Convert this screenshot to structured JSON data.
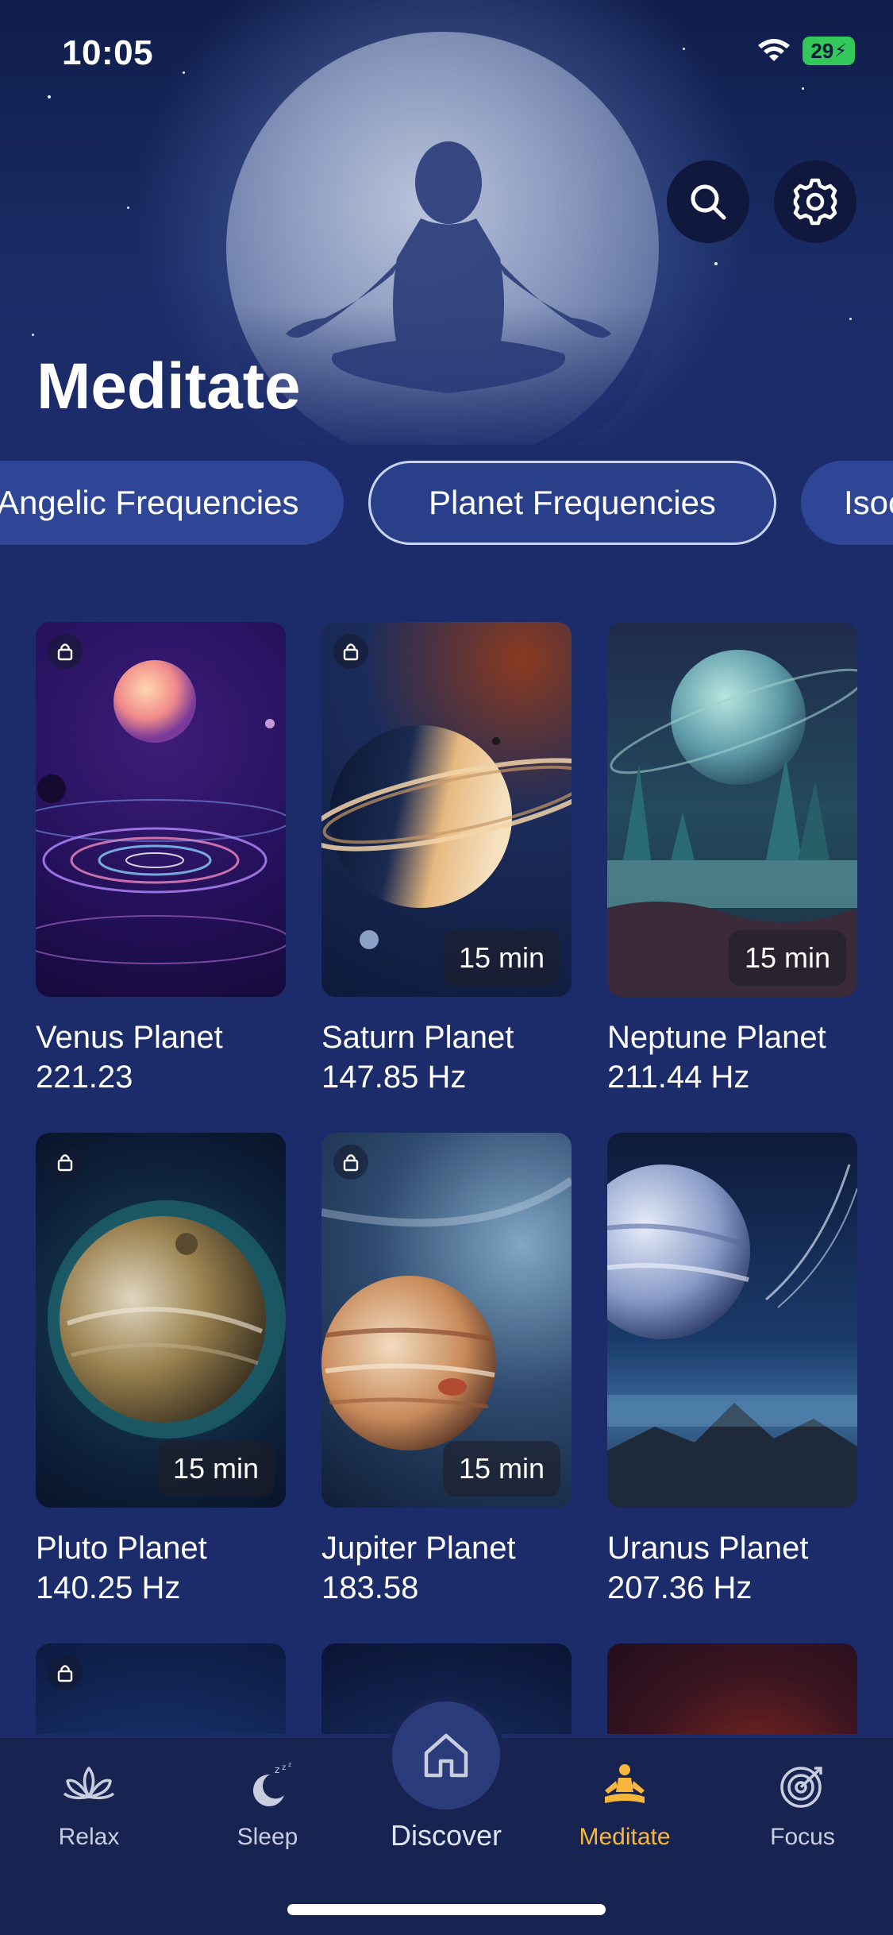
{
  "status_bar": {
    "time": "10:05",
    "battery": "29"
  },
  "header": {
    "title": "Meditate"
  },
  "categories": [
    {
      "label": "Angelic Frequencies",
      "active": false
    },
    {
      "label": "Planet Frequencies",
      "active": true
    },
    {
      "label": "Isochronic Tones",
      "active": false
    }
  ],
  "cards": [
    {
      "title": "Venus Planet",
      "subtitle": "221.23",
      "duration": "",
      "locked": true
    },
    {
      "title": "Saturn Planet",
      "subtitle": "147.85 Hz",
      "duration": "15 min",
      "locked": true
    },
    {
      "title": "Neptune Planet",
      "subtitle": "211.44 Hz",
      "duration": "15 min",
      "locked": false
    },
    {
      "title": "Pluto Planet",
      "subtitle": "140.25 Hz",
      "duration": "15 min",
      "locked": true
    },
    {
      "title": "Jupiter Planet",
      "subtitle": "183.58",
      "duration": "15 min",
      "locked": true
    },
    {
      "title": "Uranus Planet",
      "subtitle": "207.36  Hz",
      "duration": "",
      "locked": false
    }
  ],
  "tabs": {
    "relax": "Relax",
    "sleep": "Sleep",
    "discover": "Discover",
    "meditate": "Meditate",
    "focus": "Focus"
  },
  "colors": {
    "background": "#1c2b6a",
    "tab_active": "#f6b73c",
    "chip_active_border": "#c9d3f2"
  }
}
